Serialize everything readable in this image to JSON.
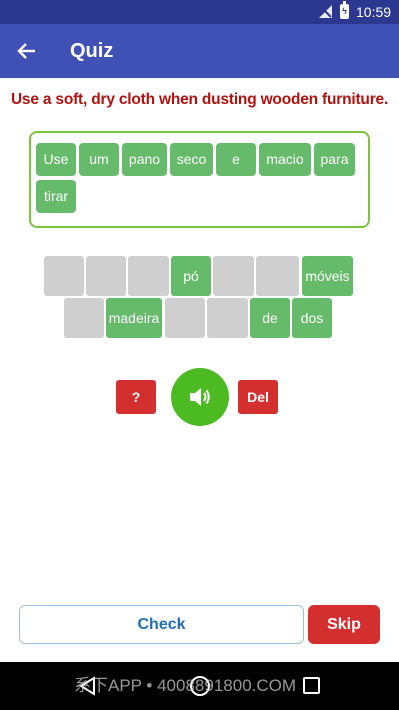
{
  "status_bar": {
    "time": "10:59",
    "icons": [
      "signal-off-icon",
      "battery-charging-icon"
    ]
  },
  "app_bar": {
    "title": "Quiz",
    "back_icon": "arrow-left-icon"
  },
  "prompt": "Use a soft, dry cloth when dusting wooden furniture.",
  "answer_chips": [
    "Use",
    "um",
    "pano",
    "seco",
    "e",
    "macio",
    "para",
    "tirar"
  ],
  "word_bank": {
    "row1": [
      "",
      "",
      "",
      "pó",
      "",
      "",
      "móveis"
    ],
    "row2": [
      "",
      "madeira",
      "",
      "",
      "de",
      "dos"
    ]
  },
  "controls": {
    "hint_label": "?",
    "sound_icon": "speaker-icon",
    "delete_label": "Del"
  },
  "actions": {
    "check_label": "Check",
    "skip_label": "Skip"
  },
  "watermark": "系下APP • 4008891800.COM",
  "colors": {
    "status_bar": "#2c3890",
    "app_bar": "#3f51b5",
    "prompt": "#b0120e",
    "chip": "#66bb6a",
    "empty_tile": "#cfcfcf",
    "danger": "#d32f2f",
    "sound": "#4cba21",
    "answer_border": "#7bc43c",
    "check_text": "#1f6fb7"
  }
}
